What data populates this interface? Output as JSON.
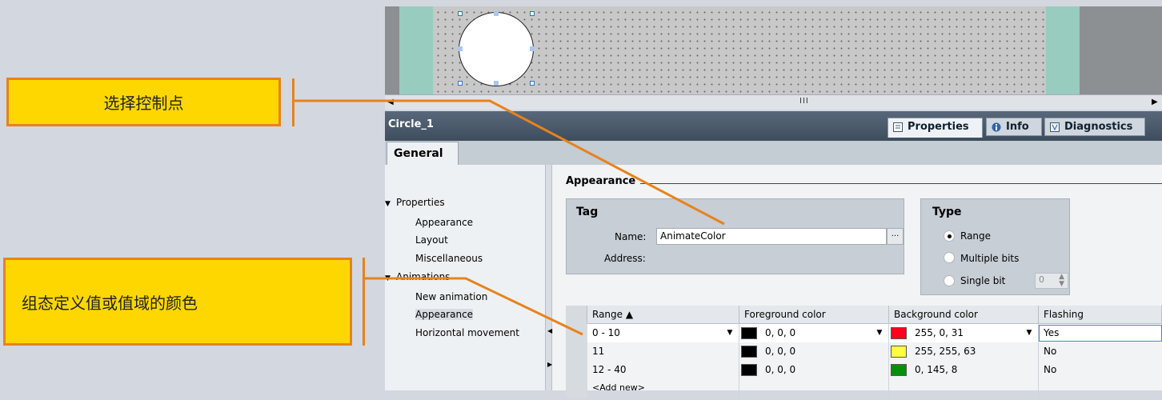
{
  "callouts": {
    "select_control_points": "选择控制点",
    "configure_colors": "组态定义值或值域的颜色"
  },
  "canvas": {
    "object_shape": "circle",
    "scrollbar_grip": "III"
  },
  "inspector": {
    "object_name": "Circle_1",
    "tabs": [
      {
        "label": "Properties",
        "icon": "properties-icon",
        "active": true
      },
      {
        "label": "Info",
        "icon": "info-icon",
        "active": false
      },
      {
        "label": "Diagnostics",
        "icon": "diagnostics-icon",
        "active": false
      }
    ],
    "general_tab": "General"
  },
  "tree": {
    "properties": "Properties",
    "appearance": "Appearance",
    "layout": "Layout",
    "miscellaneous": "Miscellaneous",
    "animations": "Animations",
    "new_animation": "New animation",
    "anim_appearance": "Appearance",
    "horizontal_movement": "Horizontal movement"
  },
  "appearance": {
    "section_title": "Appearance",
    "tag_group": {
      "title": "Tag",
      "name_label": "Name:",
      "name_value": "AnimateColor",
      "browse_label": "...",
      "address_label": "Address:"
    },
    "type_group": {
      "title": "Type",
      "options": [
        "Range",
        "Multiple bits",
        "Single bit"
      ],
      "selected": "Range",
      "bit_value": "0"
    },
    "table": {
      "headers": [
        "Range ▲",
        "Foreground color",
        "Background color",
        "Flashing"
      ],
      "rows": [
        {
          "range": "0 - 10",
          "fg": "0, 0, 0",
          "fg_color": "#000000",
          "bg": "255, 0, 31",
          "bg_color": "#ff001f",
          "flashing": "Yes"
        },
        {
          "range": "11",
          "fg": "0, 0, 0",
          "fg_color": "#000000",
          "bg": "255, 255, 63",
          "bg_color": "#ffff3f",
          "flashing": "No"
        },
        {
          "range": "12 - 40",
          "fg": "0, 0, 0",
          "fg_color": "#000000",
          "bg": "0, 145, 8",
          "bg_color": "#009108",
          "flashing": "No"
        }
      ],
      "add_new": "<Add new>"
    }
  },
  "colors": {
    "callout_fill": "#ffd700",
    "callout_border": "#e8821c",
    "leader_line": "#e8821c"
  }
}
